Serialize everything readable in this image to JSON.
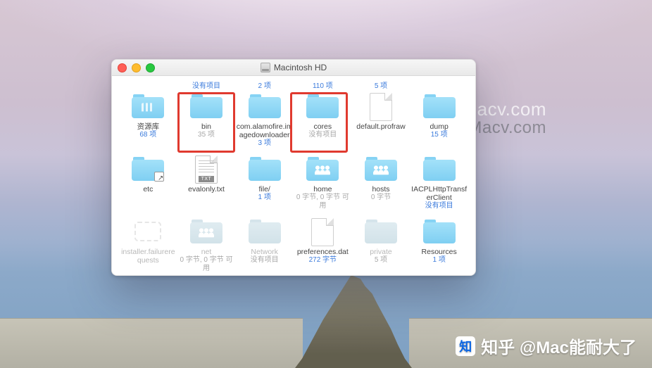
{
  "window": {
    "title": "Macintosh HD"
  },
  "topstubs": [
    {
      "l1": "",
      "l2": ""
    },
    {
      "l1": "",
      "l2": "没有项目"
    },
    {
      "l1": "",
      "l2": "2 项"
    },
    {
      "l1": "",
      "l2": "110 项"
    },
    {
      "l1": "",
      "l2": "5 项"
    },
    {
      "l1": "",
      "l2": ""
    }
  ],
  "rows": [
    [
      {
        "icon": "folder-lib",
        "name": "资源库",
        "sub": "68 项",
        "subClass": ""
      },
      {
        "icon": "folder",
        "name": "bin",
        "sub": "35 项",
        "subClass": "gray",
        "highlight": true
      },
      {
        "icon": "folder",
        "name": "com.alamofire.imagedownloader",
        "sub": "3 项",
        "subClass": ""
      },
      {
        "icon": "folder",
        "name": "cores",
        "sub": "没有项目",
        "subClass": "gray",
        "highlight": true
      },
      {
        "icon": "doc-blank",
        "name": "default.profraw",
        "sub": "",
        "subClass": ""
      },
      {
        "icon": "folder",
        "name": "dump",
        "sub": "15 项",
        "subClass": ""
      }
    ],
    [
      {
        "icon": "folder-alias",
        "name": "etc",
        "sub": "",
        "subClass": ""
      },
      {
        "icon": "doc-txt",
        "name": "evalonly.txt",
        "sub": "",
        "subClass": ""
      },
      {
        "icon": "folder",
        "name": "file/",
        "sub": "1 项",
        "subClass": ""
      },
      {
        "icon": "folder-people",
        "name": "home",
        "sub": "0 字节, 0 字节 可用",
        "subClass": "gray"
      },
      {
        "icon": "folder-people",
        "name": "hosts",
        "sub": "0 字节",
        "subClass": "gray"
      },
      {
        "icon": "folder",
        "name": "IACPLHttpTransferClient",
        "sub": "没有项目",
        "subClass": ""
      }
    ],
    [
      {
        "icon": "hollow",
        "name": "installer.failurerequests",
        "sub": "",
        "subClass": "",
        "faded": true
      },
      {
        "icon": "folder-people",
        "name": "net",
        "sub": "0 字节, 0 字节 可用",
        "subClass": "gray",
        "faded": true
      },
      {
        "icon": "folder",
        "name": "Network",
        "sub": "没有项目",
        "subClass": "gray",
        "faded": true
      },
      {
        "icon": "doc-blank",
        "name": "preferences.dat",
        "sub": "272 字节",
        "subClass": "",
        "keep": true
      },
      {
        "icon": "folder",
        "name": "private",
        "sub": "5 项",
        "subClass": "gray",
        "faded": true
      },
      {
        "icon": "folder",
        "name": "Resources",
        "sub": "1 项",
        "subClass": "",
        "keep": true
      }
    ]
  ],
  "watermark": {
    "line1": "acv.com",
    "line2": "Macv.com"
  },
  "credit": {
    "logo": "知",
    "text": "知乎 @Mac能耐大了"
  }
}
